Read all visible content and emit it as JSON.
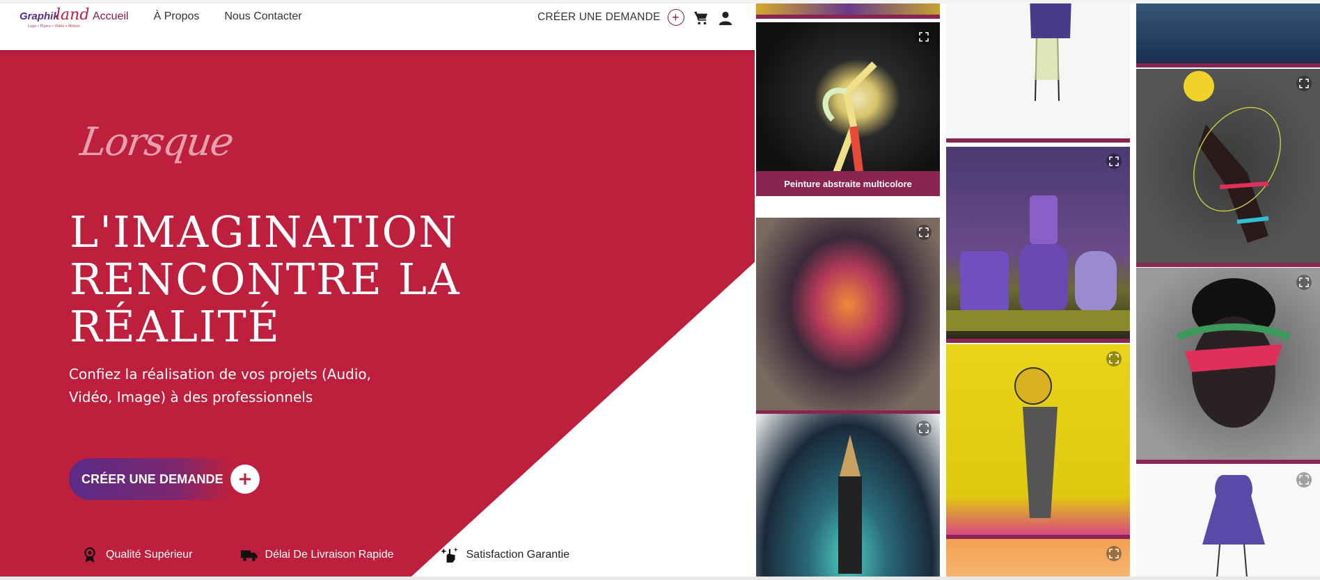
{
  "brand": {
    "logo_word1": "Graphik",
    "logo_word2": "land",
    "logo_tagline": "Logo • Flyers • Vidéo • Motion"
  },
  "nav": {
    "items": [
      {
        "label": "Accueil",
        "active": true
      },
      {
        "label": "À Propos",
        "active": false
      },
      {
        "label": "Nous Contacter",
        "active": false
      }
    ],
    "cta_label": "CRÉER UNE DEMANDE",
    "cart_icon": "cart-icon",
    "user_icon": "user-icon"
  },
  "hero": {
    "script_word": "Lorsque",
    "headline": [
      "L'IMAGINATION",
      "RENCONTRE LA",
      "RÉALITÉ"
    ],
    "subtitle": "Confiez la réalisation de vos projets (Audio, Vidéo, Image) à des professionnels",
    "cta_label": "CRÉER UNE DEMANDE",
    "cta_icon": "plus-icon",
    "features": [
      {
        "icon": "award-icon",
        "label": "Qualité Supérieur"
      },
      {
        "icon": "delivery-truck-icon",
        "label": "Délai De Livraison Rapide"
      },
      {
        "icon": "sparkle-hand-icon",
        "label": "Satisfaction Garantie"
      }
    ]
  },
  "gallery": {
    "caption": "Peinture abstraite multicolore",
    "expand_icon": "expand-icon"
  },
  "colors": {
    "brand_red": "#bd1f3d",
    "brand_purple": "#5b2a86",
    "tile_border": "#8a2450"
  }
}
